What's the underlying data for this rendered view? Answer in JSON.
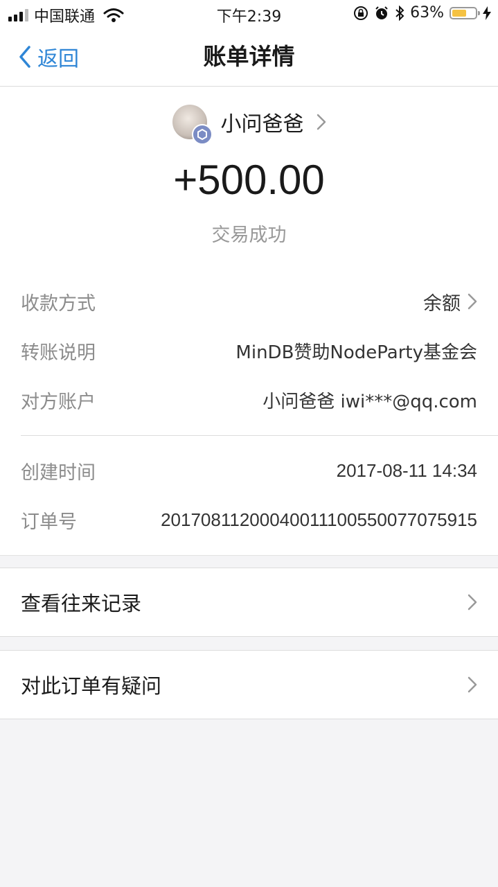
{
  "status_bar": {
    "carrier": "中国联通",
    "time": "下午2:39",
    "battery_pct": "63%",
    "battery_level": 0.63,
    "icons": [
      "signal-icon",
      "wifi-icon",
      "rotation-lock-icon",
      "alarm-icon",
      "bluetooth-icon",
      "battery-icon",
      "charging-icon"
    ]
  },
  "nav": {
    "back_label": "返回",
    "title": "账单详情"
  },
  "header": {
    "user_name": "小问爸爸",
    "amount": "+500.00",
    "status": "交易成功"
  },
  "details": {
    "payment_method": {
      "label": "收款方式",
      "value": "余额"
    },
    "transfer_note": {
      "label": "转账说明",
      "value": "MinDB赞助NodeParty基金会"
    },
    "counterparty": {
      "label": "对方账户",
      "value": "小问爸爸 iwi***@qq.com"
    },
    "created_time": {
      "label": "创建时间",
      "value": "2017-08-11 14:34"
    },
    "order_no": {
      "label": "订单号",
      "value": "20170811200040011100550077075915"
    }
  },
  "actions": {
    "view_history": "查看往来记录",
    "order_question": "对此订单有疑问"
  },
  "colors": {
    "accent": "#2f86d6",
    "background": "#f4f4f6",
    "battery": "#f5c242",
    "label_gray": "#8c8c8c"
  }
}
